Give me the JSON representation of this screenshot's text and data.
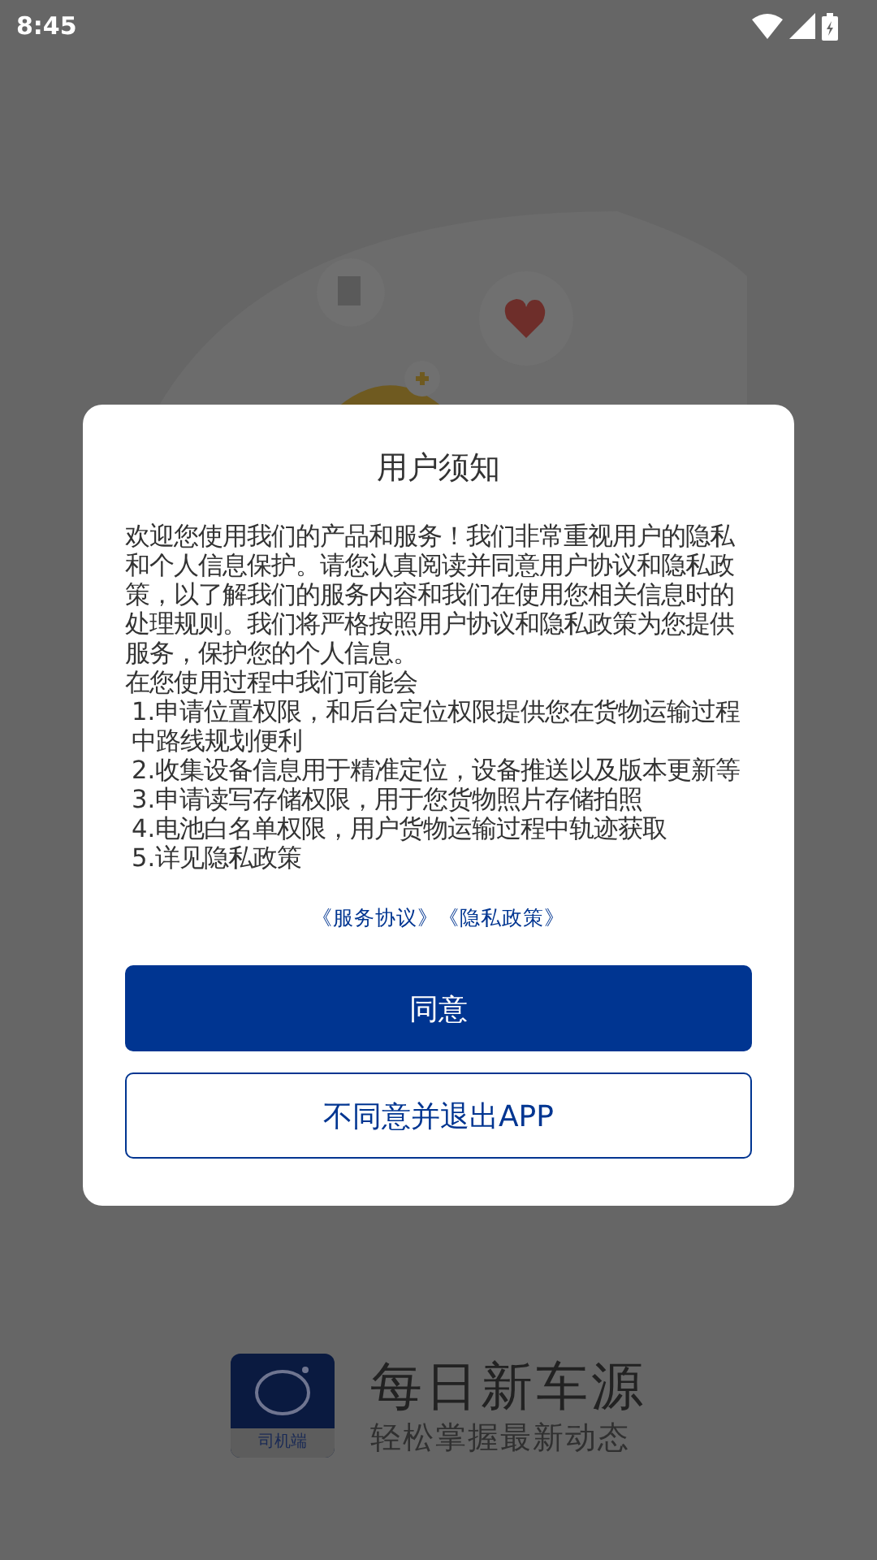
{
  "status_bar": {
    "time": "8:45"
  },
  "dialog": {
    "title": "用户须知",
    "intro": "欢迎您使用我们的产品和服务！我们非常重视用户的隐私和个人信息保护。请您认真阅读并同意用户协议和隐私政策，以了解我们的服务内容和我们在使用您相关信息时的处理规则。我们将严格按照用户协议和隐私政策为您提供服务，保护您的个人信息。",
    "lead": "在您使用过程中我们可能会",
    "items": [
      "1.申请位置权限，和后台定位权限提供您在货物运输过程中路线规划便利",
      "2.收集设备信息用于精准定位，设备推送以及版本更新等",
      "3.申请读写存储权限，用于您货物照片存储拍照",
      "4.电池白名单权限，用户货物运输过程中轨迹获取",
      "5.详见隐私政策"
    ],
    "links": [
      "《服务协议》",
      "《隐私政策》"
    ],
    "buttons": [
      {
        "label": "同意",
        "kind": "primary"
      },
      {
        "label": "不同意并退出APP",
        "kind": "outline"
      }
    ]
  },
  "brand": {
    "badge": "司机端",
    "name": "每日新车源",
    "slogan": "轻松掌握最新动态"
  }
}
